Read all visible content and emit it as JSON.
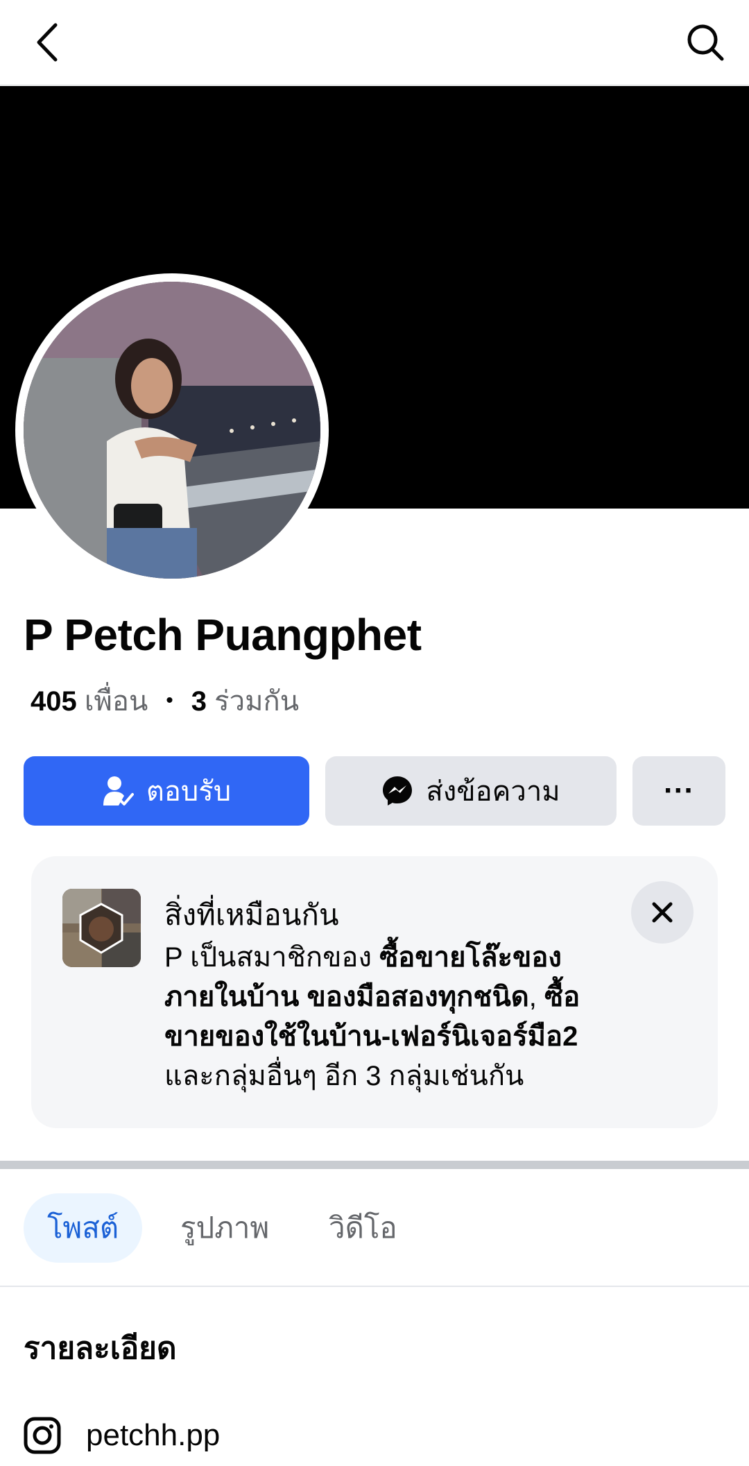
{
  "header": {
    "back_icon": "chevron-left-icon",
    "search_icon": "search-icon"
  },
  "profile": {
    "name": "P Petch Puangphet",
    "friends_count": "405",
    "friends_label": "เพื่อน",
    "mutual_count": "3",
    "mutual_label": "ร่วมกัน"
  },
  "actions": {
    "accept_label": "ตอบรับ",
    "message_label": "ส่งข้อความ",
    "more_label": "···"
  },
  "common_card": {
    "title": "สิ่งที่เหมือนกัน",
    "text_prefix": "P เป็นสมาชิกของ ",
    "group1": "ซื้อขายโล๊ะของภายในบ้าน ของมือสองทุกชนิด",
    "comma": ",",
    "group2": "ซื้อขายของใช้ในบ้าน-เฟอร์นิเจอร์มือ2",
    "text_suffix": " และกลุ่มอื่นๆ อีก 3 กลุ่มเช่นกัน"
  },
  "tabs": [
    {
      "label": "โพสต์",
      "active": true
    },
    {
      "label": "รูปภาพ",
      "active": false
    },
    {
      "label": "วิดีโอ",
      "active": false
    }
  ],
  "details": {
    "title": "รายละเอียด",
    "instagram": "petchh.pp"
  },
  "colors": {
    "accent": "#3067f5",
    "tab_active_text": "#1b61d6",
    "tab_active_bg": "#ebf5ff"
  }
}
